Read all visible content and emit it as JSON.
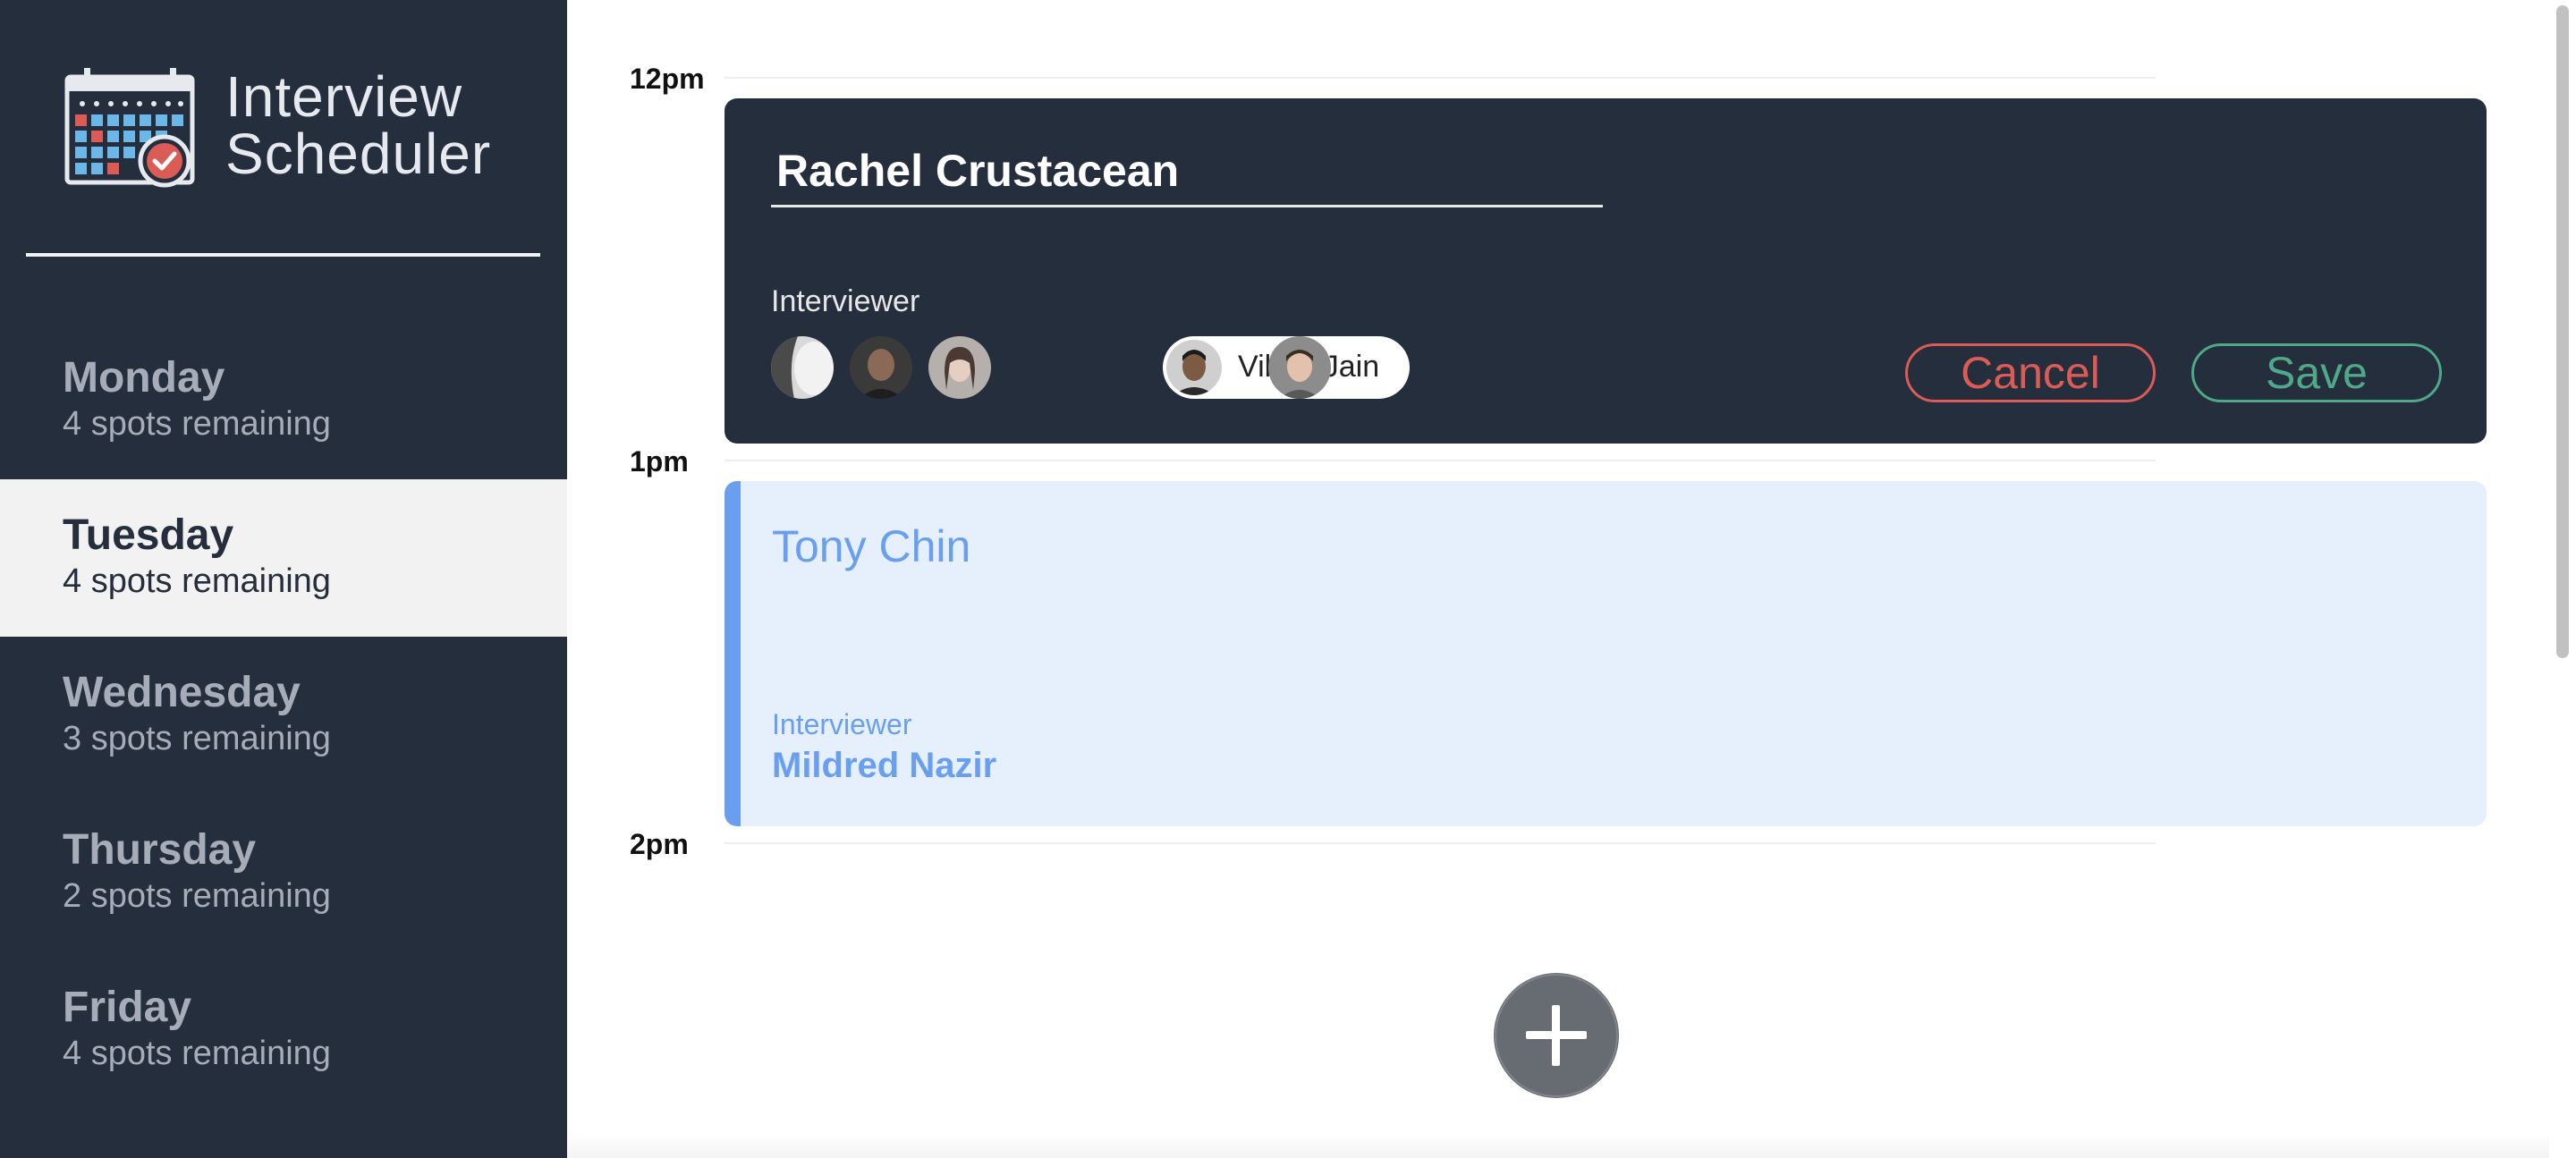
{
  "app": {
    "title_line1": "Interview",
    "title_line2": "Scheduler",
    "logo_icon": "calendar-check-icon"
  },
  "days": [
    {
      "name": "Monday",
      "spots": "4 spots remaining",
      "selected": false
    },
    {
      "name": "Tuesday",
      "spots": "4 spots remaining",
      "selected": true
    },
    {
      "name": "Wednesday",
      "spots": "3 spots remaining",
      "selected": false
    },
    {
      "name": "Thursday",
      "spots": "2 spots remaining",
      "selected": false
    },
    {
      "name": "Friday",
      "spots": "4 spots remaining",
      "selected": false
    }
  ],
  "schedule": {
    "times": [
      "12pm",
      "1pm",
      "2pm"
    ],
    "form": {
      "student_value": "Rachel Crustacean",
      "interviewer_heading": "Interviewer",
      "selected_interviewer": "Viktor Jain",
      "cancel_label": "Cancel",
      "save_label": "Save"
    },
    "appointment": {
      "student": "Tony Chin",
      "interviewer_heading": "Interviewer",
      "interviewer_name": "Mildred Nazir"
    },
    "add_icon": "plus-icon"
  },
  "colors": {
    "sidebar": "#252e3c",
    "selected_day_bg": "#f2f2f2",
    "cancel": "#db5c56",
    "save": "#4fa888",
    "appointment_accent": "#6a9ff0",
    "appointment_bg": "#e6effc"
  }
}
